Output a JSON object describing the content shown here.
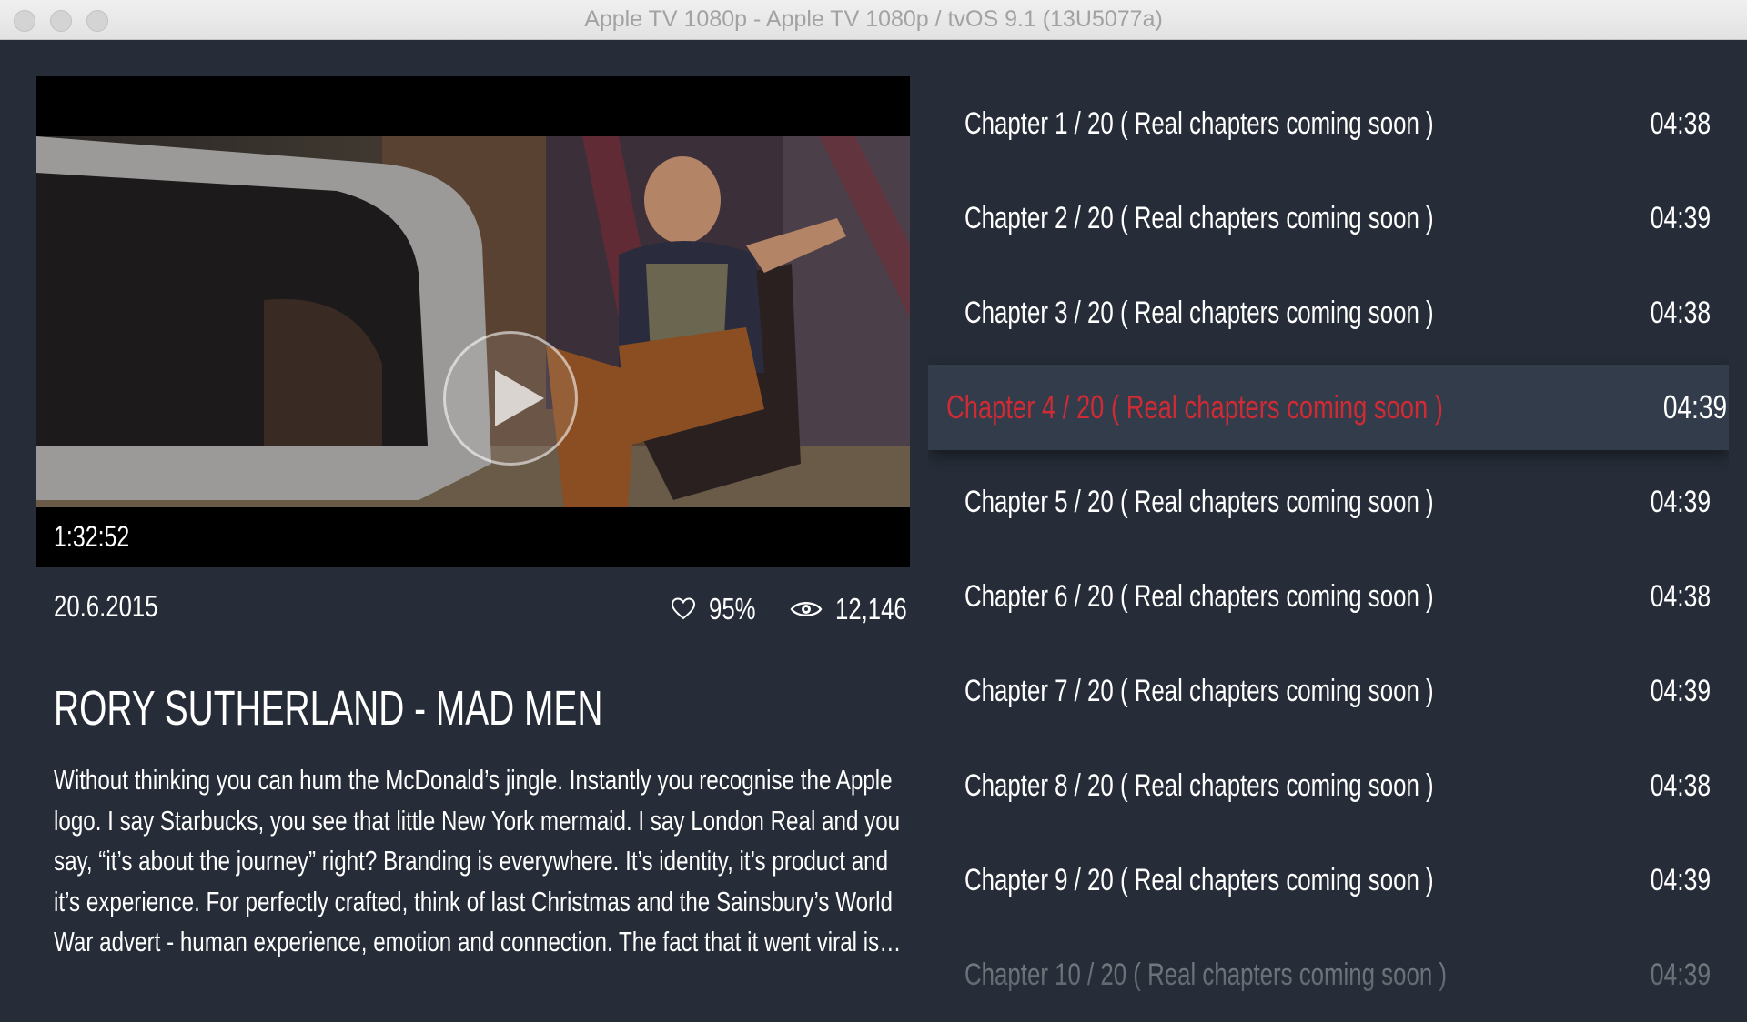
{
  "window": {
    "title": "Apple TV 1080p - Apple TV 1080p / tvOS 9.1 (13U5077a)"
  },
  "player": {
    "duration": "1:32:52",
    "play_icon": "play-icon"
  },
  "meta": {
    "date": "20.6.2015",
    "likes": "95%",
    "likes_icon": "heart-icon",
    "views": "12,146",
    "views_icon": "eye-icon"
  },
  "video": {
    "title": "RORY SUTHERLAND - MAD MEN",
    "description": "Without thinking you can hum the McDonald’s jingle. Instantly you recognise the Apple logo. I say Starbucks, you see that little New York mermaid. I say London Real and you say, “it’s about the journey” right? Branding is everywhere. It’s identity, it’s product and it’s experience. For perfectly crafted, think of last Christmas and the Sainsbury’s World War advert - human experience, emotion and connection. The fact that it went viral is proof t…"
  },
  "chapters": [
    {
      "label": "Chapter 1 / 20  ( Real chapters coming soon )",
      "time": "04:38"
    },
    {
      "label": "Chapter 2 / 20  ( Real chapters coming soon )",
      "time": "04:39"
    },
    {
      "label": "Chapter 3 / 20  ( Real chapters coming soon )",
      "time": "04:38"
    },
    {
      "label": "Chapter 4 / 20  ( Real chapters coming soon )",
      "time": "04:39"
    },
    {
      "label": "Chapter 5 / 20  ( Real chapters coming soon )",
      "time": "04:39"
    },
    {
      "label": "Chapter 6 / 20  ( Real chapters coming soon )",
      "time": "04:38"
    },
    {
      "label": "Chapter 7 / 20  ( Real chapters coming soon )",
      "time": "04:39"
    },
    {
      "label": "Chapter 8 / 20  ( Real chapters coming soon )",
      "time": "04:38"
    },
    {
      "label": "Chapter 9 / 20  ( Real chapters coming soon )",
      "time": "04:39"
    },
    {
      "label": "Chapter 10 / 20  ( Real chapters coming soon )",
      "time": "04:39"
    }
  ],
  "selected_chapter": 4,
  "colors": {
    "background": "#262d38",
    "selected_row": "#323c4a",
    "accent": "#cf2b34",
    "text": "#ffffff"
  }
}
